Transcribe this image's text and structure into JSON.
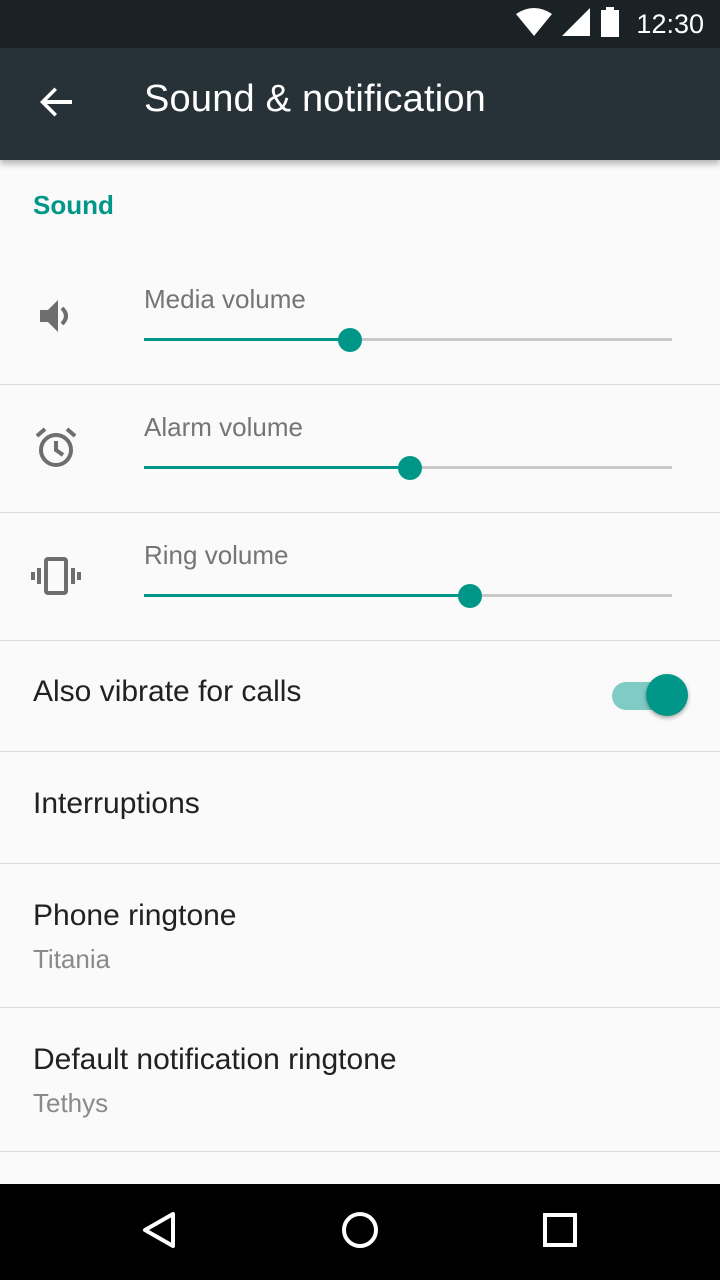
{
  "status_bar": {
    "time": "12:30",
    "icons": [
      "wifi-icon",
      "cell-signal-icon",
      "battery-icon"
    ]
  },
  "app_bar": {
    "title": "Sound & notification",
    "back_icon": "arrow-back-icon"
  },
  "sound_section": {
    "header": "Sound",
    "volumes": [
      {
        "label": "Media volume",
        "icon": "speaker-icon",
        "level": 0.39
      },
      {
        "label": "Alarm volume",
        "icon": "alarm-icon",
        "level": 0.504
      },
      {
        "label": "Ring volume",
        "icon": "vibrate-icon",
        "level": 0.617
      }
    ]
  },
  "prefs": {
    "vibrate": {
      "title": "Also vibrate for calls",
      "enabled": true
    },
    "interruptions": {
      "title": "Interruptions"
    },
    "phone_ringtone": {
      "title": "Phone ringtone",
      "summary": "Titania"
    },
    "notification_ringtone": {
      "title": "Default notification ringtone",
      "summary": "Tethys"
    }
  },
  "nav_bar": {
    "buttons": [
      "back-triangle-icon",
      "home-circle-icon",
      "recents-square-icon"
    ]
  },
  "colors": {
    "accent": "#009688",
    "app_bar": "#263238",
    "status_bar": "#1b2226",
    "background": "#fafafa"
  }
}
